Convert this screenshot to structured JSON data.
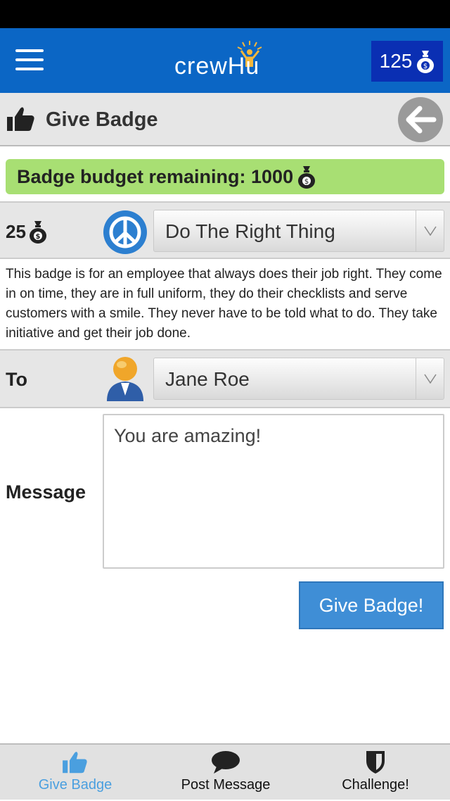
{
  "header": {
    "logo_text": "crewHu",
    "coins": "125"
  },
  "title_bar": {
    "title": "Give Badge"
  },
  "budget": {
    "label": "Badge budget remaining: 1000"
  },
  "badge": {
    "cost": "25",
    "selected": "Do The Right Thing",
    "description": "This badge is for an employee that always does their job right. They come in on time, they are in full uniform, they do their checklists and serve customers with a smile. They never have to be told what to do. They take initiative and get their job done."
  },
  "recipient": {
    "label": "To",
    "selected": "Jane Roe"
  },
  "message": {
    "label": "Message",
    "value": "You are amazing!"
  },
  "submit_label": "Give Badge!",
  "tabs": [
    {
      "label": "Give Badge",
      "active": true
    },
    {
      "label": "Post Message",
      "active": false
    },
    {
      "label": "Challenge!",
      "active": false
    }
  ],
  "colors": {
    "header": "#0b66c5",
    "coin_box": "#0a2fb3",
    "budget_bg": "#a8df73",
    "button": "#3f8ed6",
    "active_tab": "#4a9fdf"
  }
}
